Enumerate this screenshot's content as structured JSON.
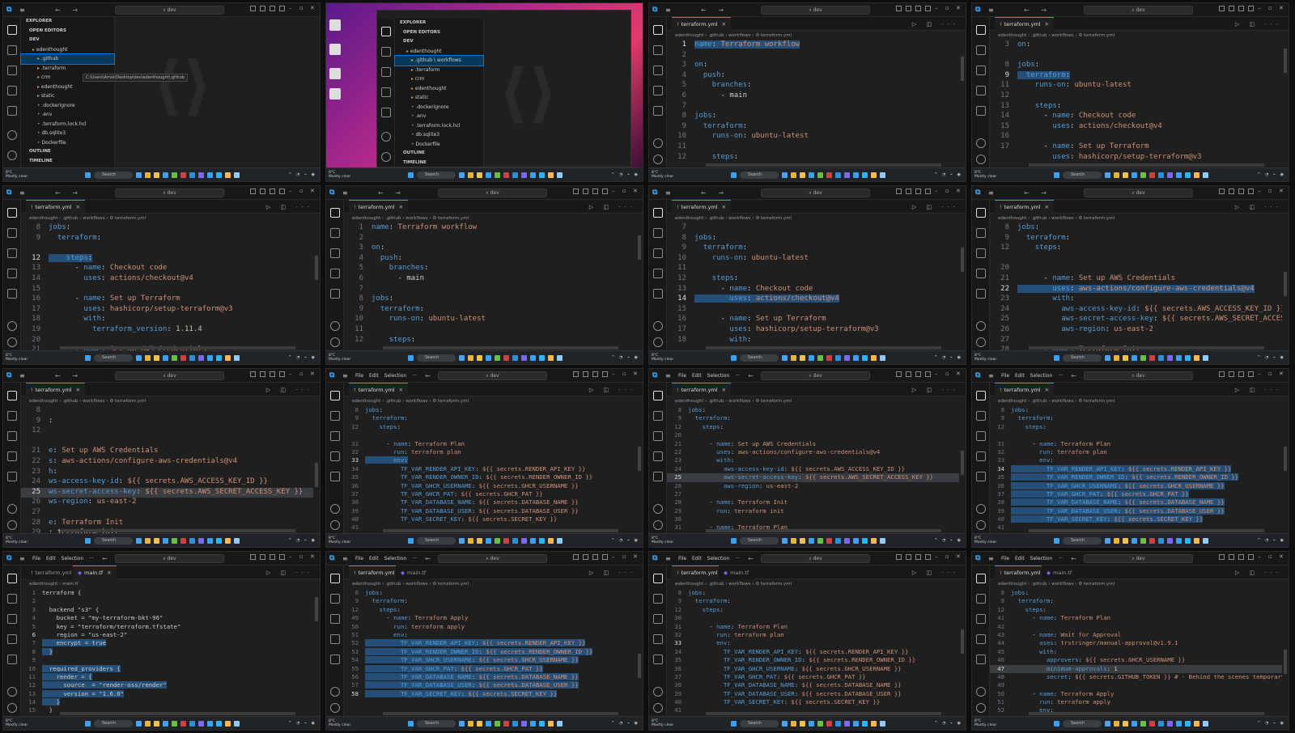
{
  "common": {
    "search_label": "dev",
    "taskbar_search": "Search",
    "weather_temp": "8°C",
    "weather_desc": "Mostly clear",
    "file_name": "terraform.yml",
    "file_name_tf": "main.tf",
    "breadcrumb": "edenthought › .github › workflows › ⚙ terraform.yml",
    "breadcrumb_tf": "edenthought › main.tf",
    "menu_file": "File",
    "menu_edit": "Edit",
    "menu_selection": "Selection",
    "menu_more": "···"
  },
  "explorer": {
    "title": "EXPLORER",
    "open_editors": "OPEN EDITORS",
    "folder": "DEV",
    "outline": "OUTLINE",
    "timeline": "TIMELINE",
    "tooltip": "C:\\Users\\Arnie\\Desktop\\dev\\edenthought\\.github",
    "items_p1": [
      "edenthought",
      ".github",
      ".terraform",
      "crm",
      "edenthought",
      "static",
      ".dockerignore",
      ".env",
      ".terraform.lock.hcl",
      "db.sqlite3",
      "Dockerfile"
    ],
    "items_p2": [
      "edenthought",
      ".github \\ workflows",
      ".terraform",
      "crm",
      "edenthought",
      "static",
      ".dockerignore",
      ".env",
      ".terraform.lock.hcl",
      "db.sqlite3",
      "Dockerfile"
    ]
  },
  "panels": [
    {
      "lines": []
    },
    {
      "lines": []
    },
    {
      "lines": [
        [
          "1",
          "name: Terraform workflow"
        ],
        [
          "2",
          ""
        ],
        [
          "3",
          "on:"
        ],
        [
          "4",
          "  push:"
        ],
        [
          "5",
          "    branches:"
        ],
        [
          "6",
          "      - main"
        ],
        [
          "7",
          ""
        ],
        [
          "8",
          "jobs:"
        ],
        [
          "9",
          "  terraform:"
        ],
        [
          "10",
          "    runs-on: ubuntu-latest"
        ],
        [
          "11",
          ""
        ],
        [
          "12",
          "    steps:"
        ]
      ]
    },
    {
      "lines": [
        [
          "3",
          "on:"
        ],
        [
          "",
          ""
        ],
        [
          "8",
          "jobs:"
        ],
        [
          "9",
          "  terraform:"
        ],
        [
          "11",
          "    runs-on: ubuntu-latest"
        ],
        [
          "12",
          ""
        ],
        [
          "13",
          "    steps:"
        ],
        [
          "14",
          "      - name: Checkout code"
        ],
        [
          "15",
          "        uses: actions/checkout@v4"
        ],
        [
          "16",
          ""
        ],
        [
          "17",
          "      - name: Set up Terraform"
        ],
        [
          "",
          "        uses: hashicorp/setup-terraform@v3"
        ]
      ]
    },
    {
      "lines": [
        [
          "8",
          "jobs:"
        ],
        [
          "9",
          "  terraform:"
        ],
        [
          "",
          ""
        ],
        [
          "12",
          "    steps:"
        ],
        [
          "13",
          "      - name: Checkout code"
        ],
        [
          "14",
          "        uses: actions/checkout@v4"
        ],
        [
          "15",
          ""
        ],
        [
          "16",
          "      - name: Set up Terraform"
        ],
        [
          "17",
          "        uses: hashicorp/setup-terraform@v3"
        ],
        [
          "18",
          "        with:"
        ],
        [
          "19",
          "          terraform_version: 1.11.4"
        ],
        [
          "20",
          ""
        ],
        [
          "21",
          "      - name: Set up AWS Credentials"
        ]
      ]
    },
    {
      "lines": [
        [
          "1",
          "name: Terraform workflow"
        ],
        [
          "2",
          ""
        ],
        [
          "3",
          "on:"
        ],
        [
          "4",
          "  push:"
        ],
        [
          "5",
          "    branches:"
        ],
        [
          "6",
          "      - main"
        ],
        [
          "7",
          ""
        ],
        [
          "8",
          "jobs:"
        ],
        [
          "9",
          "  terraform:"
        ],
        [
          "10",
          "    runs-on: ubuntu-latest"
        ],
        [
          "11",
          ""
        ],
        [
          "12",
          "    steps:"
        ]
      ]
    },
    {
      "lines": [
        [
          "7",
          ""
        ],
        [
          "8",
          "jobs:"
        ],
        [
          "9",
          "  terraform:"
        ],
        [
          "10",
          "    runs-on: ubuntu-latest"
        ],
        [
          "11",
          ""
        ],
        [
          "12",
          "    steps:"
        ],
        [
          "13",
          "      - name: Checkout code"
        ],
        [
          "14",
          "        uses: actions/checkout@v4"
        ],
        [
          "15",
          ""
        ],
        [
          "16",
          "      - name: Set up Terraform"
        ],
        [
          "17",
          "        uses: hashicorp/setup-terraform@v3"
        ],
        [
          "18",
          "        with:"
        ]
      ]
    },
    {
      "lines": [
        [
          "8",
          "jobs:"
        ],
        [
          "9",
          "  terraform:"
        ],
        [
          "12",
          "    steps:"
        ],
        [
          "",
          ""
        ],
        [
          "20",
          ""
        ],
        [
          "21",
          "      - name: Set up AWS Credentials"
        ],
        [
          "22",
          "        uses: aws-actions/configure-aws-credentials@v4"
        ],
        [
          "23",
          "        with:"
        ],
        [
          "24",
          "          aws-access-key-id: ${{ secrets.AWS_ACCESS_KEY_ID }}"
        ],
        [
          "25",
          "          aws-secret-access-key: ${{ secrets.AWS_SECRET_ACCESS_KEY }}"
        ],
        [
          "26",
          "          aws-region: us-east-2"
        ],
        [
          "27",
          ""
        ],
        [
          "28",
          "      - name: Terraform Init"
        ]
      ]
    },
    {
      "lines": [
        [
          "8",
          ""
        ],
        [
          "9",
          ":"
        ],
        [
          "12",
          ""
        ],
        [
          "",
          ""
        ],
        [
          "21",
          "e: Set up AWS Credentials"
        ],
        [
          "22",
          "s: aws-actions/configure-aws-credentials@v4"
        ],
        [
          "23",
          "h:"
        ],
        [
          "24",
          "ws-access-key-id: ${{ secrets.AWS_ACCESS_KEY_ID }}"
        ],
        [
          "25",
          "ws-secret-access-key: ${{ secrets.AWS_SECRET_ACCESS_KEY }}"
        ],
        [
          "26",
          "ws-region: us-east-2"
        ],
        [
          "27",
          ""
        ],
        [
          "28",
          "e: Terraform Init"
        ],
        [
          "29",
          ": terraform init"
        ]
      ]
    },
    {
      "lines": [
        [
          "8",
          "jobs:"
        ],
        [
          "9",
          "  terraform:"
        ],
        [
          "12",
          "    steps:"
        ],
        [
          "",
          ""
        ],
        [
          "31",
          "      - name: Terraform Plan"
        ],
        [
          "32",
          "        run: terraform plan"
        ],
        [
          "33",
          "        env:"
        ],
        [
          "34",
          "          TF_VAR_RENDER_API_KEY: ${{ secrets.RENDER_API_KEY }}"
        ],
        [
          "35",
          "          TF_VAR_RENDER_OWNER_ID: ${{ secrets.RENDER_OWNER_ID }}"
        ],
        [
          "36",
          "          TF_VAR_GHCR_USERNAME: ${{ secrets.GHCR_USERNAME }}"
        ],
        [
          "37",
          "          TF_VAR_GHCR_PAT: ${{ secrets.GHCR_PAT }}"
        ],
        [
          "38",
          "          TF_VAR_DATABASE_NAME: ${{ secrets.DATABASE_NAME }}"
        ],
        [
          "39",
          "          TF_VAR_DATABASE_USER: ${{ secrets.DATABASE_USER }}"
        ],
        [
          "40",
          "          TF_VAR_SECRET_KEY: ${{ secrets.SECRET_KEY }}"
        ],
        [
          "41",
          ""
        ],
        [
          "42",
          "      - name: Wait for Approval"
        ]
      ]
    },
    {
      "lines": [
        [
          "8",
          "jobs:"
        ],
        [
          "9",
          "  terraform:"
        ],
        [
          "12",
          "    steps:"
        ],
        [
          "20",
          ""
        ],
        [
          "21",
          "      - name: Set up AWS Credentials"
        ],
        [
          "22",
          "        uses: aws-actions/configure-aws-credentials@v4"
        ],
        [
          "23",
          "        with:"
        ],
        [
          "24",
          "          aws-access-key-id: ${{ secrets.AWS_ACCESS_KEY_ID }}"
        ],
        [
          "25",
          "          aws-secret-access-key: ${{ secrets.AWS_SECRET_ACCESS_KEY }}"
        ],
        [
          "26",
          "          aws-region: us-east-2"
        ],
        [
          "27",
          ""
        ],
        [
          "28",
          "      - name: Terraform Init"
        ],
        [
          "29",
          "        run: terraform init"
        ],
        [
          "30",
          ""
        ],
        [
          "31",
          "      - name: Terraform Plan"
        ],
        [
          "32",
          "        run: terraform plan"
        ]
      ]
    },
    {
      "lines": [
        [
          "8",
          "jobs:"
        ],
        [
          "9",
          "  terraform:"
        ],
        [
          "12",
          "    steps:"
        ],
        [
          "",
          ""
        ],
        [
          "31",
          "      - name: Terraform Plan"
        ],
        [
          "32",
          "        run: terraform plan"
        ],
        [
          "33",
          "        env:"
        ],
        [
          "34",
          "          TF_VAR_RENDER_API_KEY: ${{ secrets.RENDER_API_KEY }}"
        ],
        [
          "35",
          "          TF_VAR_RENDER_OWNER_ID: ${{ secrets.RENDER_OWNER_ID }}"
        ],
        [
          "36",
          "          TF_VAR_GHCR_USERNAME: ${{ secrets.GHCR_USERNAME }}"
        ],
        [
          "37",
          "          TF_VAR_GHCR_PAT: ${{ secrets.GHCR_PAT }}"
        ],
        [
          "38",
          "          TF_VAR_DATABASE_NAME: ${{ secrets.DATABASE_NAME }}"
        ],
        [
          "39",
          "          TF_VAR_DATABASE_USER: ${{ secrets.DATABASE_USER }}"
        ],
        [
          "40",
          "          TF_VAR_SECRET_KEY: ${{ secrets.SECRET_KEY }}"
        ],
        [
          "41",
          ""
        ],
        [
          "42",
          "      - name: Wait for Approval"
        ]
      ]
    },
    {
      "lines": [
        [
          "1",
          "terraform {"
        ],
        [
          "2",
          ""
        ],
        [
          "3",
          "  backend \"s3\" {"
        ],
        [
          "4",
          "    bucket = \"my-terraform-bkt-96\""
        ],
        [
          "5",
          "    key = \"terraform/terraform.tfstate\""
        ],
        [
          "6",
          "    region = \"us-east-2\""
        ],
        [
          "7",
          "    encrypt = true"
        ],
        [
          "8",
          "  }"
        ],
        [
          "9",
          ""
        ],
        [
          "10",
          "  required_providers {"
        ],
        [
          "11",
          "    render = {"
        ],
        [
          "12",
          "      source  = \"render-oss/render\""
        ],
        [
          "13",
          "      version = \"1.6.0\""
        ],
        [
          "14",
          "    }"
        ],
        [
          "15",
          "  }"
        ]
      ]
    },
    {
      "lines": [
        [
          "8",
          "jobs:"
        ],
        [
          "9",
          "  terraform:"
        ],
        [
          "12",
          "    steps:"
        ],
        [
          "49",
          "      - name: Terraform Apply"
        ],
        [
          "50",
          "        run: terraform apply"
        ],
        [
          "51",
          "        env:"
        ],
        [
          "52",
          "          TF_VAR_RENDER_API_KEY: ${{ secrets.RENDER_API_KEY }}"
        ],
        [
          "53",
          "          TF_VAR_RENDER_OWNER_ID: ${{ secrets.RENDER_OWNER_ID }}"
        ],
        [
          "54",
          "          TF_VAR_GHCR_USERNAME: ${{ secrets.GHCR_USERNAME }}"
        ],
        [
          "55",
          "          TF_VAR_GHCR_PAT: ${{ secrets.GHCR_PAT }}"
        ],
        [
          "56",
          "          TF_VAR_DATABASE_NAME: ${{ secrets.DATABASE_NAME }}"
        ],
        [
          "57",
          "          TF_VAR_DATABASE_USER: ${{ secrets.DATABASE_USER }}"
        ],
        [
          "58",
          "          TF_VAR_SECRET_KEY: ${{ secrets.SECRET_KEY }}"
        ]
      ]
    },
    {
      "lines": [
        [
          "8",
          "jobs:"
        ],
        [
          "9",
          "  terraform:"
        ],
        [
          "12",
          "    steps:"
        ],
        [
          "30",
          ""
        ],
        [
          "31",
          "      - name: Terraform Plan"
        ],
        [
          "32",
          "        run: terraform plan"
        ],
        [
          "33",
          "        env:"
        ],
        [
          "34",
          "          TF_VAR_RENDER_API_KEY: ${{ secrets.RENDER_API_KEY }}"
        ],
        [
          "35",
          "          TF_VAR_RENDER_OWNER_ID: ${{ secrets.RENDER_OWNER_ID }}"
        ],
        [
          "36",
          "          TF_VAR_GHCR_USERNAME: ${{ secrets.GHCR_USERNAME }}"
        ],
        [
          "37",
          "          TF_VAR_GHCR_PAT: ${{ secrets.GHCR_PAT }}"
        ],
        [
          "38",
          "          TF_VAR_DATABASE_NAME: ${{ secrets.DATABASE_NAME }}"
        ],
        [
          "39",
          "          TF_VAR_DATABASE_USER: ${{ secrets.DATABASE_USER }}"
        ],
        [
          "40",
          "          TF_VAR_SECRET_KEY: ${{ secrets.SECRET_KEY }}"
        ],
        [
          "41",
          ""
        ],
        [
          "42",
          "      - name: Wait for Approval"
        ]
      ]
    },
    {
      "lines": [
        [
          "8",
          "jobs:"
        ],
        [
          "9",
          "  terraform:"
        ],
        [
          "12",
          "    steps:"
        ],
        [
          "41",
          "      - name: Terraform Plan"
        ],
        [
          "42",
          ""
        ],
        [
          "43",
          "      - name: Wait for Approval"
        ],
        [
          "44",
          "        uses: trstringer/manual-approval@v1.9.1"
        ],
        [
          "45",
          "        with:"
        ],
        [
          "46",
          "          approvers: ${{ secrets.GHCR_USERNAME }}"
        ],
        [
          "47",
          "          minimum-approvals: 1"
        ],
        [
          "48",
          "          secret: ${{ secrets.GITHUB_TOKEN }} # - Behind the scenes temporary"
        ],
        [
          "49",
          ""
        ],
        [
          "50",
          "      - name: Terraform Apply"
        ],
        [
          "51",
          "        run: terraform apply"
        ],
        [
          "52",
          "        env:"
        ],
        [
          "53",
          "          TF_VAR_RENDER_API_KEY: ${{ secrets.RENDER_API_KEY }}"
        ]
      ]
    }
  ]
}
